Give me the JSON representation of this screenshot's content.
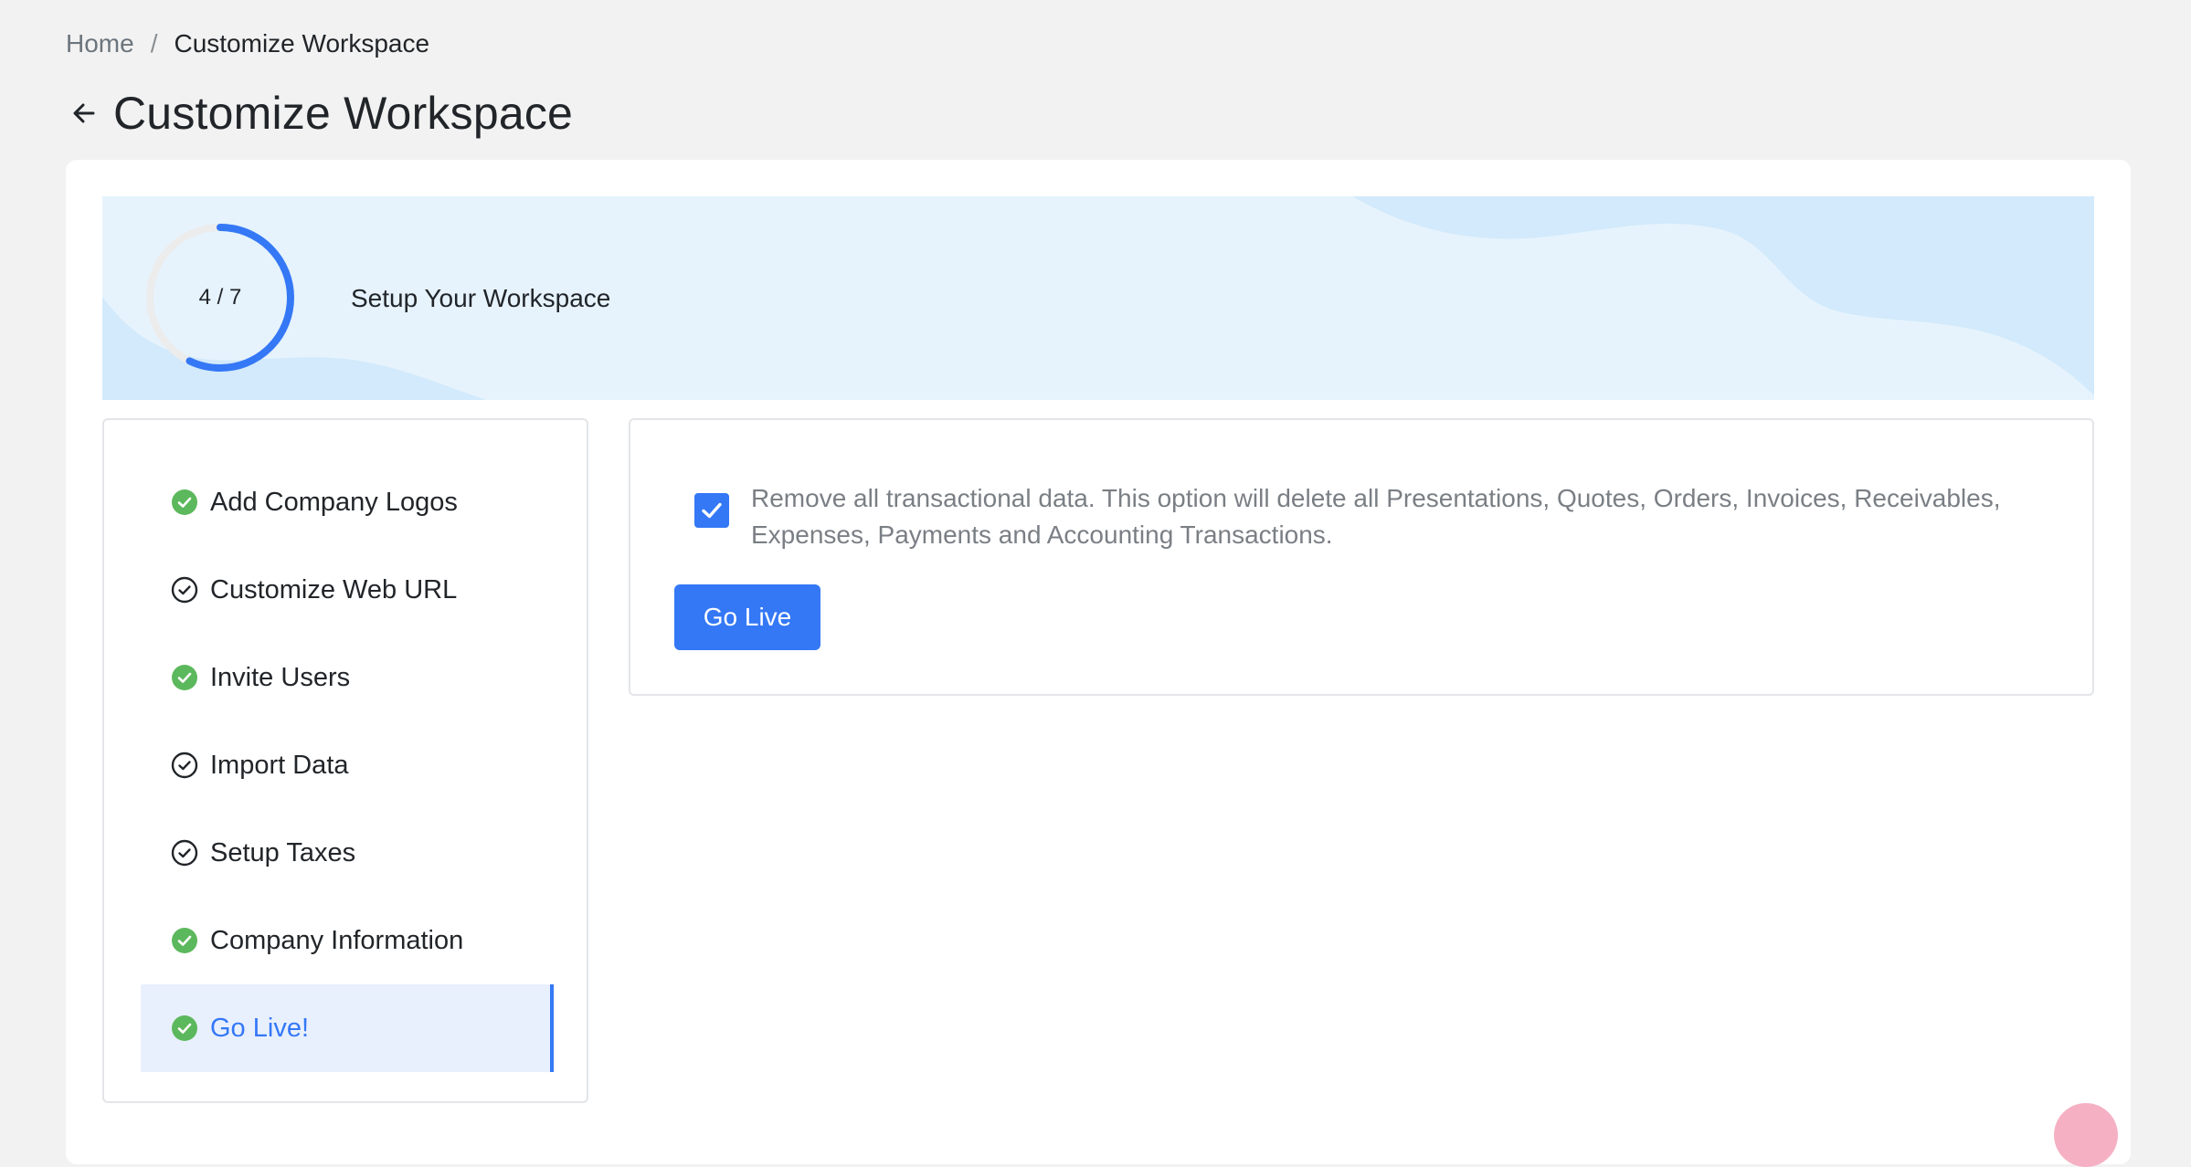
{
  "breadcrumb": {
    "home": "Home",
    "separator": "/",
    "current": "Customize Workspace"
  },
  "header": {
    "title": "Customize Workspace",
    "back_icon": "arrow-left-icon"
  },
  "banner": {
    "progress_text": "4 / 7",
    "progress_completed": 4,
    "progress_total": 7,
    "title": "Setup Your Workspace"
  },
  "steps": [
    {
      "label": "Add Company Logos",
      "status": "complete"
    },
    {
      "label": "Customize Web URL",
      "status": "incomplete"
    },
    {
      "label": "Invite Users",
      "status": "complete"
    },
    {
      "label": "Import Data",
      "status": "incomplete"
    },
    {
      "label": "Setup Taxes",
      "status": "incomplete"
    },
    {
      "label": "Company Information",
      "status": "complete"
    },
    {
      "label": "Go Live!",
      "status": "complete",
      "active": true
    }
  ],
  "go_live": {
    "checkbox_checked": true,
    "checkbox_label": "Remove all transactional data. This option will delete all Presentations, Quotes, Orders, Invoices, Receivables, Expenses, Payments and Accounting Transactions.",
    "button_label": "Go Live"
  },
  "colors": {
    "accent": "#3478f6",
    "success": "#5cb85c",
    "banner_bg": "#e6f3fd",
    "active_step_bg": "#e8f0fe",
    "page_bg": "#f2f2f2"
  }
}
